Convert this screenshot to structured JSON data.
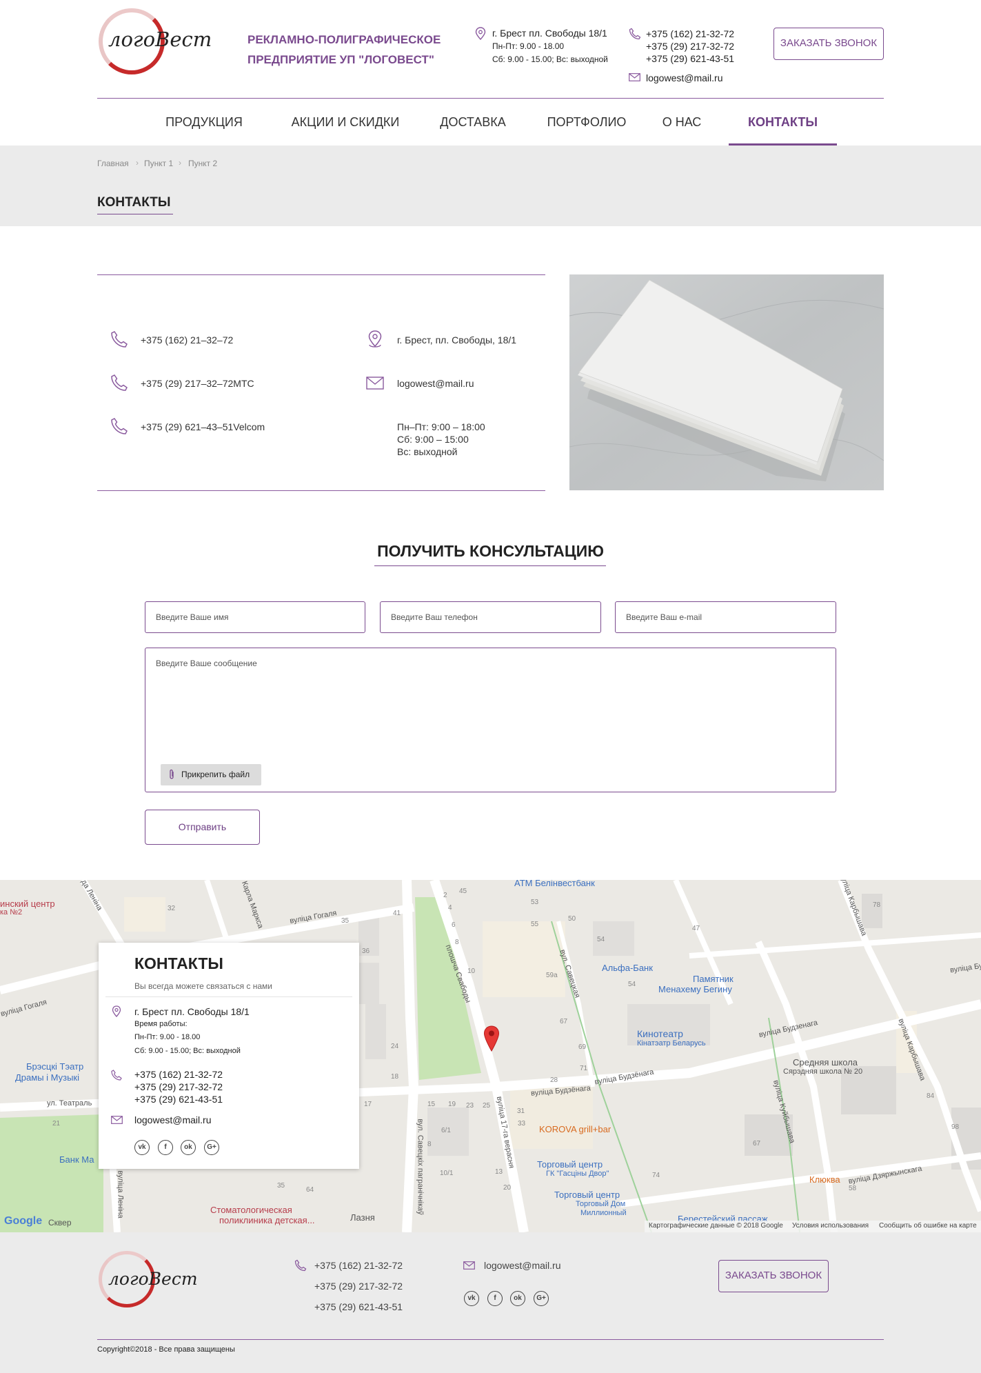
{
  "header": {
    "logo_text": "логоВест",
    "tagline": "РЕКЛАМНО-ПОЛИГРАФИЧЕСКОЕ ПРЕДПРИЯТИЕ УП \"ЛОГОВЕСТ\"",
    "address": "г. Брест пл. Свободы 18/1",
    "hours_weekdays": "Пн-Пт: 9.00 - 18.00",
    "hours_weekend": "Сб: 9.00 - 15.00; Вс: выходной",
    "phones": [
      "+375 (162) 21-32-72",
      "+375 (29) 217-32-72",
      "+375 (29) 621-43-51"
    ],
    "email": "logowest@mail.ru",
    "callback_label": "ЗАКАЗАТЬ ЗВОНОК"
  },
  "nav": {
    "items": [
      {
        "label": "ПРОДУКЦИЯ",
        "active": false
      },
      {
        "label": "АКЦИИ И СКИДКИ",
        "active": false
      },
      {
        "label": "ДОСТАВКА",
        "active": false
      },
      {
        "label": "ПОРТФОЛИО",
        "active": false
      },
      {
        "label": "О НАС",
        "active": false
      },
      {
        "label": "КОНТАКТЫ",
        "active": true
      }
    ]
  },
  "breadcrumb": [
    "Главная",
    "Пункт 1",
    "Пункт 2"
  ],
  "page_title": "КОНТАКТЫ",
  "contacts": {
    "phones": [
      "+375 (162) 21–32–72",
      "+375 (29) 217–32–72МТС",
      "+375 (29) 621–43–51Velcom"
    ],
    "address": "г. Брест, пл. Свободы, 18/1",
    "email": "logowest@mail.ru",
    "hours": [
      "Пн–Пт: 9:00 – 18:00",
      "Сб: 9:00 – 15:00",
      "Вс: выходной"
    ]
  },
  "form": {
    "title": "ПОЛУЧИТЬ КОНСУЛЬТАЦИЮ",
    "name_placeholder": "Введите Ваше имя",
    "phone_placeholder": "Введите Ваш телефон",
    "email_placeholder": "Введите Ваш e-mail",
    "message_placeholder": "Введите Ваше сообщение",
    "attach_label": "Прикрепить файл",
    "submit_label": "Отправить"
  },
  "map": {
    "card": {
      "title": "КОНТАКТЫ",
      "subtitle": "Вы всегда можете связаться с нами",
      "address": "г. Брест пл. Свободы 18/1",
      "hours_label": "Время работы:",
      "hours_weekdays": "Пн-Пт: 9.00 - 18.00",
      "hours_weekend": "Сб: 9.00 - 15.00; Вс: выходной",
      "phones": [
        "+375 (162) 21-32-72",
        "+375 (29) 217-32-72",
        "+375 (29) 621-43-51"
      ],
      "email": "logowest@mail.ru",
      "social": [
        "vk",
        "f",
        "ok",
        "G+"
      ]
    },
    "labels": {
      "atm": "ATM Белінвестбанк",
      "alfa": "Альфа-Банк",
      "monument": "Памятник",
      "monument2": "Менахему Бегину",
      "cinema": "Кинотеатр",
      "cinema2": "Кінатэатр Беларусь",
      "school": "Средняя школа",
      "school2": "Сярэдняя школа № 20",
      "theatre": "Брэсцкі Тэатр",
      "theatre2": "Драмы і Музыкі",
      "korova": "KOROVA grill+bar",
      "mall1": "Торговый центр",
      "mall1b": "ГК \"Гасціны Двор\"",
      "mall2": "Торговый центр",
      "mall2b": "Торговый Дом",
      "mall2c": "Миллионный",
      "clinic": "Стоматологическая",
      "clinic2": "поликлиника детская...",
      "bath": "Лазня",
      "passage": "Берестейский пассаж",
      "klyukva": "Клюква",
      "bank": "Банк Ма",
      "centre": "инский центр",
      "centre2": "ка №2",
      "skver": "Сквер",
      "str_gogolya": "вуліца Гогаля",
      "str_gogalya2": "вуліца Гогаля",
      "str_marksa": "Карла Маркса",
      "str_lenina": "вуліца Леніна",
      "str_lenina2": "да Леніна",
      "str_svobody": "плошча Свабоды",
      "str_savetskaya": "вул. Савецкая",
      "str_budzennaga": "вуліца Будзёнага",
      "str_budzennaga2": "вуліца Будзёнага",
      "str_budzennaga3": "вуліца Будзенага",
      "str_17": "вуліца 17-га верасня",
      "str_pogran": "вул. Савецкіх пагранічнікаў",
      "str_kuibysheva": "вуліца Куйбышава",
      "str_karbysheva": "вуліца Карбышава",
      "str_karbysheva2": "вуліца Карбышава",
      "str_dzerzh": "вуліца Дзяржынскага",
      "str_teatr": "ул. Театраль",
      "str_bu": "вуліца Бу",
      "google": "Google",
      "attribution1": "Картографические данные © 2018 Google",
      "attribution2": "Условия использования",
      "attribution3": "Сообщить об ошибке на карте"
    },
    "numbers": [
      "45",
      "53",
      "2",
      "4",
      "6",
      "8",
      "10",
      "55",
      "50",
      "54",
      "47",
      "78",
      "59a",
      "67",
      "69",
      "71",
      "28",
      "32",
      "35",
      "41",
      "36",
      "17",
      "18",
      "24",
      "15",
      "19",
      "21",
      "23",
      "25",
      "6/1",
      "8",
      "10/1",
      "13",
      "20",
      "31",
      "33",
      "74",
      "58",
      "84",
      "98",
      "67",
      "54",
      "64",
      "35"
    ]
  },
  "footer": {
    "logo_text": "логоВест",
    "phones": [
      "+375 (162) 21-32-72",
      "+375 (29) 217-32-72",
      "+375 (29) 621-43-51"
    ],
    "email": "logowest@mail.ru",
    "social": [
      "vk",
      "f",
      "ok",
      "G+"
    ],
    "callback_label": "ЗАКАЗАТЬ ЗВОНОК",
    "copyright": "Copyright©2018 - Все права защищены"
  },
  "colors": {
    "accent": "#7a4a8e",
    "logo_red": "#c62a2a",
    "strip_bg": "#ebebeb"
  }
}
